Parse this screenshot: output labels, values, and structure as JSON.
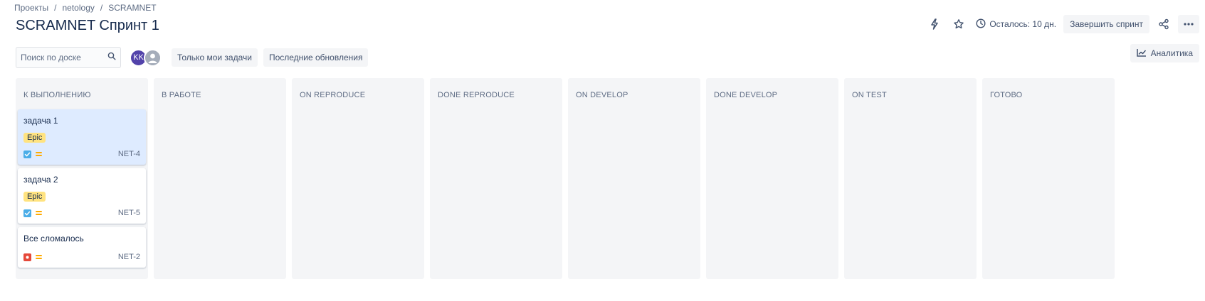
{
  "breadcrumb": [
    {
      "label": "Проекты"
    },
    {
      "label": "netology"
    },
    {
      "label": "SCRAMNET"
    }
  ],
  "breadcrumb_separator": "/",
  "page_title": "SCRAMNET Спринт 1",
  "header": {
    "time_remaining": "Осталось: 10 дн.",
    "complete_sprint_label": "Завершить спринт",
    "icons": [
      "lightning-icon",
      "star-icon",
      "clock-icon",
      "share-icon",
      "more-icon"
    ]
  },
  "toolbar": {
    "search_placeholder": "Поиск по доске",
    "avatar_initials": "KK",
    "only_my_issues_label": "Только мои задачи",
    "recent_updates_label": "Последние обновления",
    "analytics_label": "Аналитика"
  },
  "columns": [
    {
      "title": "К ВЫПОЛНЕНИЮ"
    },
    {
      "title": "В РАБОТЕ"
    },
    {
      "title": "ON REPRODUCE"
    },
    {
      "title": "DONE REPRODUCE"
    },
    {
      "title": "ON DEVELOP"
    },
    {
      "title": "DONE DEVELOP"
    },
    {
      "title": "ON TEST"
    },
    {
      "title": "ГОТОВО"
    }
  ],
  "cards": [
    {
      "title": "задача 1",
      "epic": "Epic",
      "type": "task",
      "priority": "medium",
      "key": "NET-4",
      "selected": true
    },
    {
      "title": "задача 2",
      "epic": "Epic",
      "type": "task",
      "priority": "medium",
      "key": "NET-5",
      "selected": false
    },
    {
      "title": "Все сломалось",
      "type": "bug",
      "priority": "medium",
      "key": "NET-2",
      "selected": false
    }
  ],
  "colors": {
    "accent": "#0052cc",
    "avatar": "#5243aa",
    "epic_label": "#ffe380",
    "task_icon": "#4bade8",
    "bug_icon": "#e5493a",
    "priority_medium": "#ffab00",
    "selected_card": "#deebff",
    "column_bg": "#f4f5f7"
  }
}
